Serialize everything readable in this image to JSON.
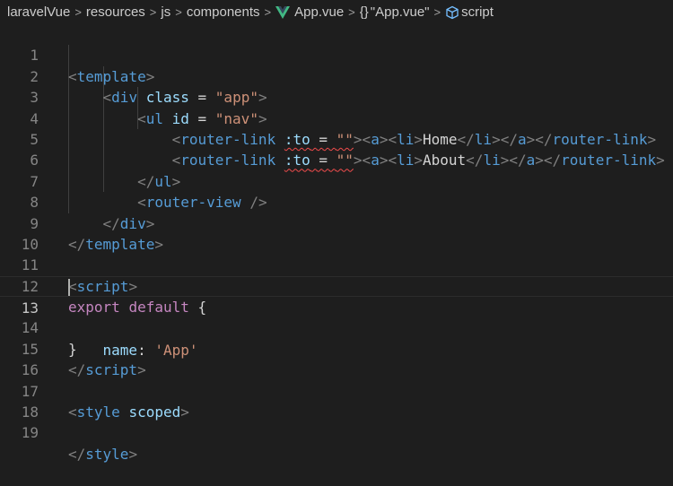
{
  "breadcrumb": {
    "items": [
      "laravelVue",
      "resources",
      "js",
      "components"
    ],
    "file": "App.vue",
    "section": "\"App.vue\"",
    "symbol": "script",
    "separator": ">"
  },
  "icons": {
    "vue": "vue-logo-icon",
    "braces": "braces-icon",
    "symbol": "cube-icon"
  },
  "colors": {
    "tag": "#569cd6",
    "attribute": "#9cdcfe",
    "string": "#ce9178",
    "keyword": "#c586c0",
    "error": "#f14c4c"
  },
  "editor": {
    "current_line": 13,
    "lines": [
      {
        "n": "1"
      },
      {
        "n": "2"
      },
      {
        "n": "3"
      },
      {
        "n": "4"
      },
      {
        "n": "5"
      },
      {
        "n": "6"
      },
      {
        "n": "7"
      },
      {
        "n": "8"
      },
      {
        "n": "9"
      },
      {
        "n": "10"
      },
      {
        "n": "11"
      },
      {
        "n": "12"
      },
      {
        "n": "13"
      },
      {
        "n": "14"
      },
      {
        "n": "15"
      },
      {
        "n": "16"
      },
      {
        "n": "17"
      },
      {
        "n": "18"
      },
      {
        "n": "19"
      }
    ],
    "tokens": {
      "template": "template",
      "div": "div",
      "class_attr": "class",
      "eq": " = ",
      "app_str": "\"app\"",
      "ul": "ul",
      "id_attr": "id",
      "nav_str": "\"nav\"",
      "router_link": "router-link",
      "to_attr": ":to",
      "empty_str": "\"\"",
      "a": "a",
      "li": "li",
      "home": "Home",
      "about": "About",
      "router_view": "router-view",
      "script": "script",
      "export": "export",
      "default": "default",
      "brace_open": "{",
      "brace_close": "}",
      "name_key": "name",
      "app_sq": "'App'",
      "style": "style",
      "scoped": "scoped"
    }
  }
}
